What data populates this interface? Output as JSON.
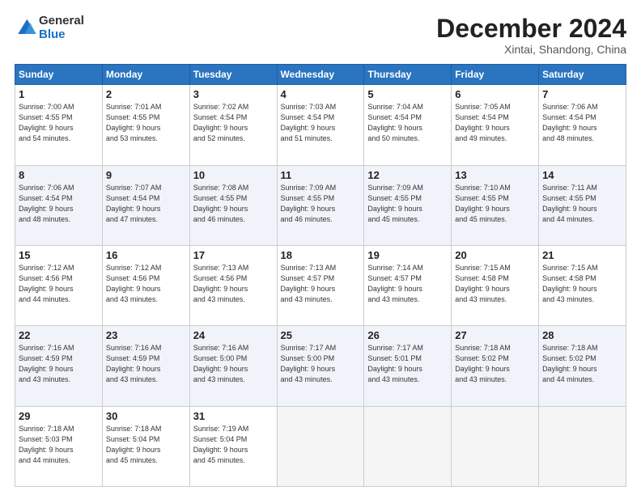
{
  "header": {
    "logo_general": "General",
    "logo_blue": "Blue",
    "month_title": "December 2024",
    "location": "Xintai, Shandong, China"
  },
  "weekdays": [
    "Sunday",
    "Monday",
    "Tuesday",
    "Wednesday",
    "Thursday",
    "Friday",
    "Saturday"
  ],
  "weeks": [
    [
      {
        "day": "1",
        "info": "Sunrise: 7:00 AM\nSunset: 4:55 PM\nDaylight: 9 hours\nand 54 minutes."
      },
      {
        "day": "2",
        "info": "Sunrise: 7:01 AM\nSunset: 4:55 PM\nDaylight: 9 hours\nand 53 minutes."
      },
      {
        "day": "3",
        "info": "Sunrise: 7:02 AM\nSunset: 4:54 PM\nDaylight: 9 hours\nand 52 minutes."
      },
      {
        "day": "4",
        "info": "Sunrise: 7:03 AM\nSunset: 4:54 PM\nDaylight: 9 hours\nand 51 minutes."
      },
      {
        "day": "5",
        "info": "Sunrise: 7:04 AM\nSunset: 4:54 PM\nDaylight: 9 hours\nand 50 minutes."
      },
      {
        "day": "6",
        "info": "Sunrise: 7:05 AM\nSunset: 4:54 PM\nDaylight: 9 hours\nand 49 minutes."
      },
      {
        "day": "7",
        "info": "Sunrise: 7:06 AM\nSunset: 4:54 PM\nDaylight: 9 hours\nand 48 minutes."
      }
    ],
    [
      {
        "day": "8",
        "info": "Sunrise: 7:06 AM\nSunset: 4:54 PM\nDaylight: 9 hours\nand 48 minutes."
      },
      {
        "day": "9",
        "info": "Sunrise: 7:07 AM\nSunset: 4:54 PM\nDaylight: 9 hours\nand 47 minutes."
      },
      {
        "day": "10",
        "info": "Sunrise: 7:08 AM\nSunset: 4:55 PM\nDaylight: 9 hours\nand 46 minutes."
      },
      {
        "day": "11",
        "info": "Sunrise: 7:09 AM\nSunset: 4:55 PM\nDaylight: 9 hours\nand 46 minutes."
      },
      {
        "day": "12",
        "info": "Sunrise: 7:09 AM\nSunset: 4:55 PM\nDaylight: 9 hours\nand 45 minutes."
      },
      {
        "day": "13",
        "info": "Sunrise: 7:10 AM\nSunset: 4:55 PM\nDaylight: 9 hours\nand 45 minutes."
      },
      {
        "day": "14",
        "info": "Sunrise: 7:11 AM\nSunset: 4:55 PM\nDaylight: 9 hours\nand 44 minutes."
      }
    ],
    [
      {
        "day": "15",
        "info": "Sunrise: 7:12 AM\nSunset: 4:56 PM\nDaylight: 9 hours\nand 44 minutes."
      },
      {
        "day": "16",
        "info": "Sunrise: 7:12 AM\nSunset: 4:56 PM\nDaylight: 9 hours\nand 43 minutes."
      },
      {
        "day": "17",
        "info": "Sunrise: 7:13 AM\nSunset: 4:56 PM\nDaylight: 9 hours\nand 43 minutes."
      },
      {
        "day": "18",
        "info": "Sunrise: 7:13 AM\nSunset: 4:57 PM\nDaylight: 9 hours\nand 43 minutes."
      },
      {
        "day": "19",
        "info": "Sunrise: 7:14 AM\nSunset: 4:57 PM\nDaylight: 9 hours\nand 43 minutes."
      },
      {
        "day": "20",
        "info": "Sunrise: 7:15 AM\nSunset: 4:58 PM\nDaylight: 9 hours\nand 43 minutes."
      },
      {
        "day": "21",
        "info": "Sunrise: 7:15 AM\nSunset: 4:58 PM\nDaylight: 9 hours\nand 43 minutes."
      }
    ],
    [
      {
        "day": "22",
        "info": "Sunrise: 7:16 AM\nSunset: 4:59 PM\nDaylight: 9 hours\nand 43 minutes."
      },
      {
        "day": "23",
        "info": "Sunrise: 7:16 AM\nSunset: 4:59 PM\nDaylight: 9 hours\nand 43 minutes."
      },
      {
        "day": "24",
        "info": "Sunrise: 7:16 AM\nSunset: 5:00 PM\nDaylight: 9 hours\nand 43 minutes."
      },
      {
        "day": "25",
        "info": "Sunrise: 7:17 AM\nSunset: 5:00 PM\nDaylight: 9 hours\nand 43 minutes."
      },
      {
        "day": "26",
        "info": "Sunrise: 7:17 AM\nSunset: 5:01 PM\nDaylight: 9 hours\nand 43 minutes."
      },
      {
        "day": "27",
        "info": "Sunrise: 7:18 AM\nSunset: 5:02 PM\nDaylight: 9 hours\nand 43 minutes."
      },
      {
        "day": "28",
        "info": "Sunrise: 7:18 AM\nSunset: 5:02 PM\nDaylight: 9 hours\nand 44 minutes."
      }
    ],
    [
      {
        "day": "29",
        "info": "Sunrise: 7:18 AM\nSunset: 5:03 PM\nDaylight: 9 hours\nand 44 minutes."
      },
      {
        "day": "30",
        "info": "Sunrise: 7:18 AM\nSunset: 5:04 PM\nDaylight: 9 hours\nand 45 minutes."
      },
      {
        "day": "31",
        "info": "Sunrise: 7:19 AM\nSunset: 5:04 PM\nDaylight: 9 hours\nand 45 minutes."
      },
      null,
      null,
      null,
      null
    ]
  ]
}
